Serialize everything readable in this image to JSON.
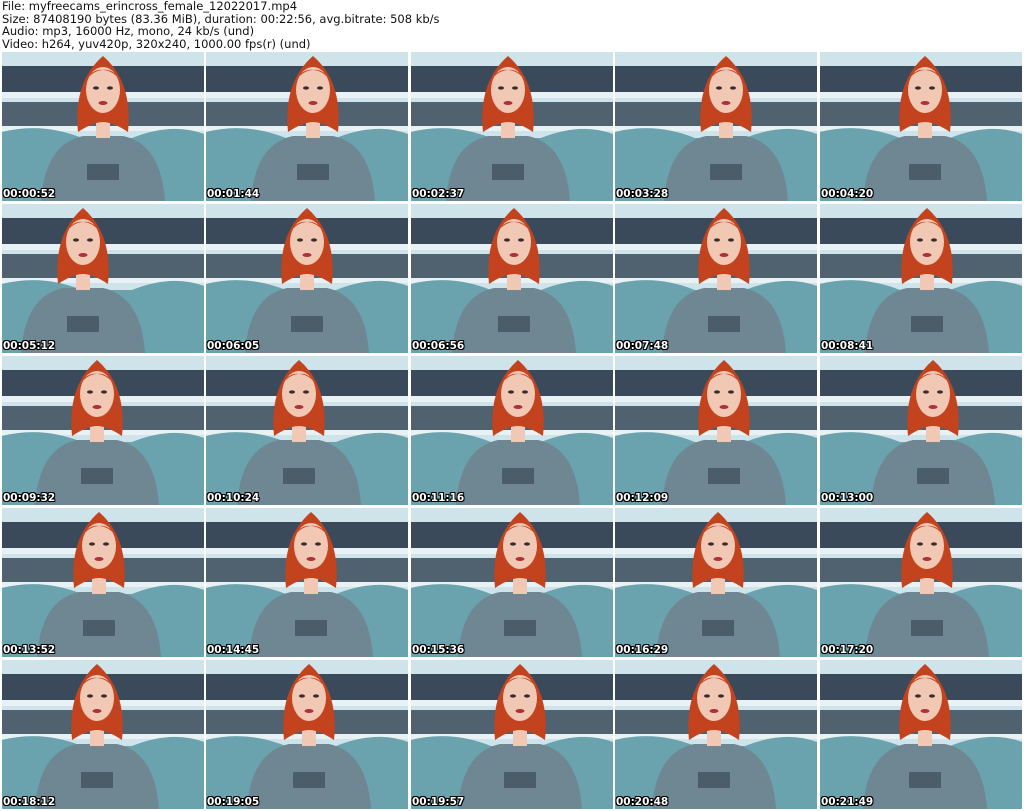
{
  "header": {
    "file_line": "File: myfreecams_erincross_female_12022017.mp4",
    "size_line": "Size: 87408190 bytes (83.36 MiB), duration: 00:22:56, avg.bitrate: 508 kb/s",
    "audio_line": "Audio: mp3, 16000 Hz, mono, 24 kb/s (und)",
    "video_line": "Video: h264, yuv420p, 320x240, 1000.00 fps(r) (und)"
  },
  "thumbnails": [
    {
      "timestamp": "00:00:52"
    },
    {
      "timestamp": "00:01:44"
    },
    {
      "timestamp": "00:02:37"
    },
    {
      "timestamp": "00:03:28"
    },
    {
      "timestamp": "00:04:20"
    },
    {
      "timestamp": "00:05:12"
    },
    {
      "timestamp": "00:06:05"
    },
    {
      "timestamp": "00:06:56"
    },
    {
      "timestamp": "00:07:48"
    },
    {
      "timestamp": "00:08:41"
    },
    {
      "timestamp": "00:09:32"
    },
    {
      "timestamp": "00:10:24"
    },
    {
      "timestamp": "00:11:16"
    },
    {
      "timestamp": "00:12:09"
    },
    {
      "timestamp": "00:13:00"
    },
    {
      "timestamp": "00:13:52"
    },
    {
      "timestamp": "00:14:45"
    },
    {
      "timestamp": "00:15:36"
    },
    {
      "timestamp": "00:16:29"
    },
    {
      "timestamp": "00:17:20"
    },
    {
      "timestamp": "00:18:12"
    },
    {
      "timestamp": "00:19:05"
    },
    {
      "timestamp": "00:19:57"
    },
    {
      "timestamp": "00:20:48"
    },
    {
      "timestamp": "00:21:49"
    }
  ],
  "colors": {
    "wall": "#cfe3ea",
    "shelf": "#e8f1f4",
    "books": "#3a4a5a",
    "couch": "#6aa3ad",
    "sweater": "#6f8793",
    "hair": "#c4431f",
    "skin": "#f0c8b4"
  }
}
